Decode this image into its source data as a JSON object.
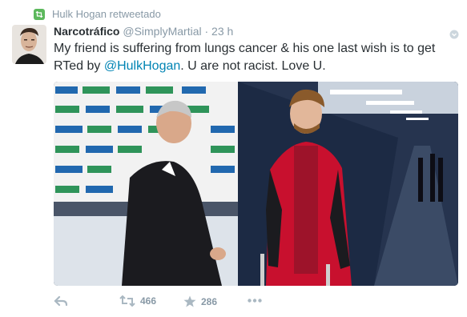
{
  "retweet_context": {
    "text": "Hulk Hogan retweetado"
  },
  "tweet": {
    "fullname": "Narcotráfico",
    "username": "@SimplyMartial",
    "separator": "·",
    "time": "23 h",
    "text_part1": "My friend is suffering from lungs cancer & his one last wish is to get RTed by ",
    "mention": "@HulkHogan",
    "text_part2": ". U are not racist. Love U."
  },
  "actions": {
    "retweets": "466",
    "favorites": "286"
  },
  "colors": {
    "retweet_green": "#5cb85c",
    "muted": "#8899a6",
    "link": "#0084b4",
    "text": "#292f33"
  },
  "icons": [
    "retweet-badge-icon",
    "caret-icon",
    "reply-icon",
    "retweet-icon",
    "star-icon",
    "more-icon"
  ]
}
